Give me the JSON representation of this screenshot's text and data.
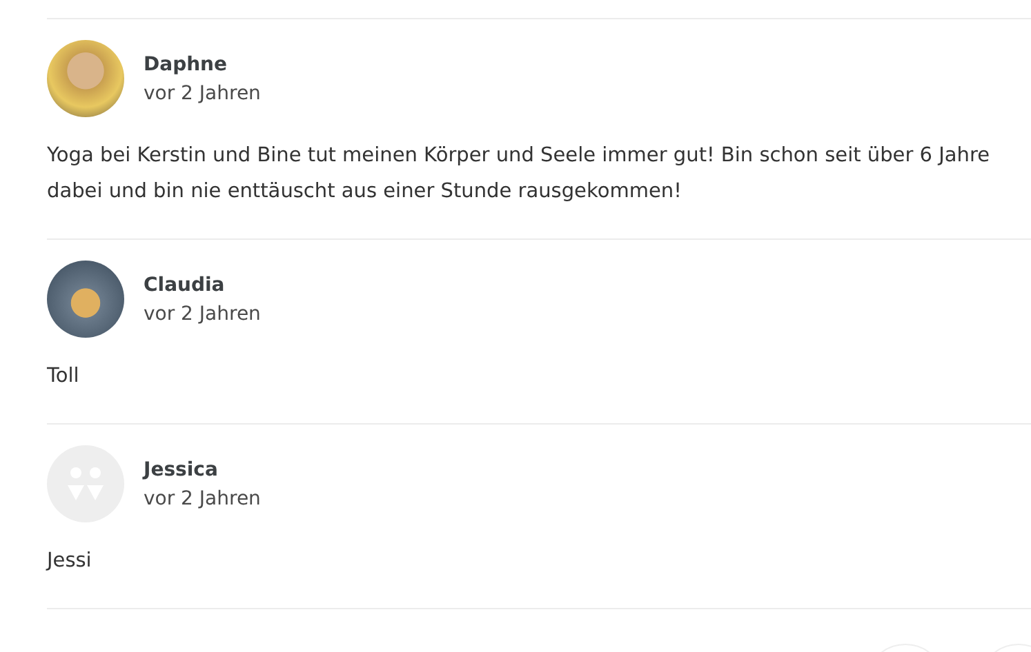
{
  "reviews": [
    {
      "name": "Daphne",
      "time": "vor 2 Jahren",
      "kind": "photo",
      "text": "Yoga bei Kerstin und Bine tut meinen Körper und Seele immer gut! Bin schon seit über 6 Jahre dabei und bin nie enttäuscht aus einer Stunde rausgekommen!"
    },
    {
      "name": "Claudia",
      "time": "vor 2 Jahren",
      "kind": "photo",
      "text": "Toll"
    },
    {
      "name": "Jessica",
      "time": "vor 2 Jahren",
      "kind": "default",
      "text": "Jessi"
    }
  ],
  "pagination": [
    {
      "kind": "round"
    },
    {
      "kind": "round"
    }
  ]
}
